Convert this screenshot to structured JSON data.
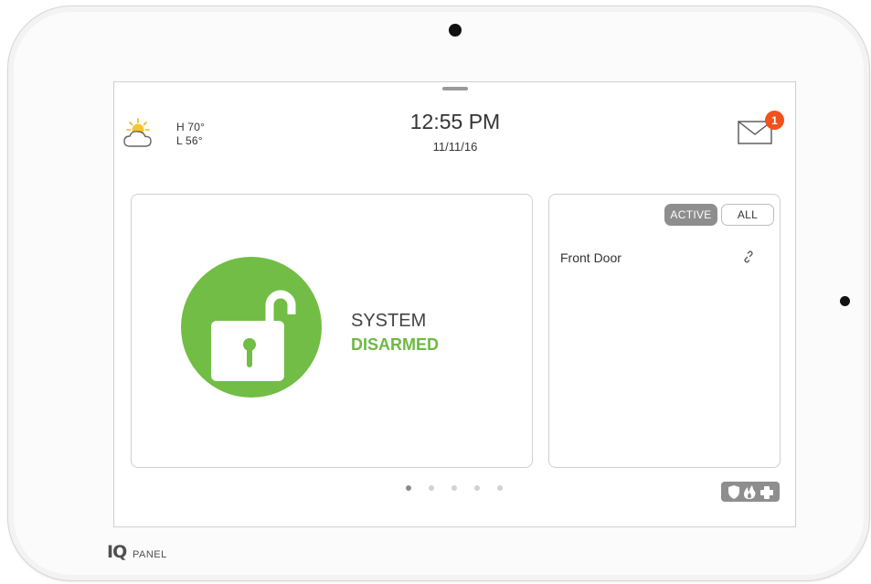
{
  "device": {
    "brand_mark": "IQ",
    "brand_word": "PANEL"
  },
  "header": {
    "weather": {
      "icon": "partly-sunny-icon",
      "high": "H 70°",
      "low": "L 56°"
    },
    "time": "12:55 PM",
    "date": "11/11/16",
    "messages": {
      "icon": "envelope-icon",
      "unread_count": "1"
    }
  },
  "security_status": {
    "icon": "unlocked-padlock-icon",
    "line1": "SYSTEM",
    "line2": "DISARMED",
    "color": "#71bd45"
  },
  "sensors": {
    "filters": [
      "ACTIVE",
      "ALL"
    ],
    "selected_filter": "ACTIVE",
    "items": [
      {
        "name": "Front Door",
        "status_icon": "open-link-icon"
      }
    ]
  },
  "pager": {
    "page_count": 5,
    "current_page": 1
  },
  "emergency_button": {
    "icons": [
      "shield-icon",
      "fire-icon",
      "medical-cross-icon"
    ],
    "color": "#8e8e8e"
  },
  "colors": {
    "accent_green": "#71bd45",
    "badge_orange": "#f0521c"
  }
}
